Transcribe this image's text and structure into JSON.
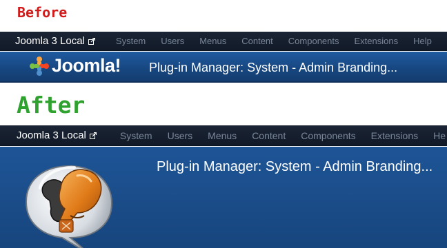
{
  "before": {
    "caption": "Before",
    "navbar": {
      "brand": "Joomla 3 Local",
      "brand_icon": "external-link-icon",
      "menu": [
        "System",
        "Users",
        "Menus",
        "Content",
        "Components",
        "Extensions",
        "Help"
      ]
    },
    "header": {
      "logo_text": "Joomla!",
      "title": "Plug-in Manager: System - Admin Branding..."
    }
  },
  "after": {
    "caption": "After",
    "navbar": {
      "brand": "Joomla 3 Local",
      "brand_icon": "external-link-icon",
      "menu": [
        "System",
        "Users",
        "Menus",
        "Content",
        "Components",
        "Extensions",
        "He"
      ]
    },
    "header": {
      "logo_icon": "boxing-gloves-speech-bubble-icon",
      "title": "Plug-in Manager: System - Admin Branding..."
    }
  },
  "colors": {
    "before_caption": "#d11b1b",
    "after_caption": "#2ea12e",
    "navbar_bg": "#1a2434",
    "header_bg": "#1b4d8a",
    "menu_text": "#7a8799"
  }
}
